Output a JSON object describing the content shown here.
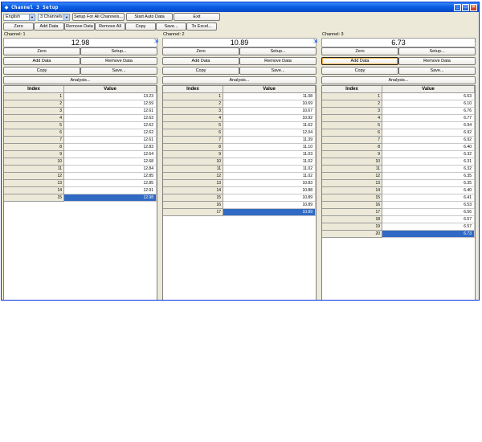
{
  "window": {
    "title": "Channel 3 Setup"
  },
  "toolbar1": {
    "language": "English",
    "channels": "3 Channels",
    "setup_all": "Setup For All Channels...",
    "start_auto": "Start Auto Data",
    "exit": "Exit"
  },
  "toolbar2": {
    "zero": "Zero",
    "add": "Add Data",
    "remove": "Remove Data",
    "remove_all": "Remove All",
    "copy": "Copy",
    "save": "Save...",
    "excel": "To Excel..."
  },
  "panel_buttons": {
    "zero": "Zero",
    "setup": "Setup...",
    "add": "Add Data",
    "remove": "Remove Data",
    "copy": "Copy",
    "save": "Save...",
    "analysis": "Analysis...",
    "index_header": "Index",
    "value_header": "Value"
  },
  "channels": [
    {
      "label": "Channel: 1",
      "reading": "12.98",
      "rows": [
        [
          "1",
          "13.23"
        ],
        [
          "2",
          "12.59"
        ],
        [
          "3",
          "12.61"
        ],
        [
          "4",
          "12.63"
        ],
        [
          "5",
          "12.62"
        ],
        [
          "6",
          "12.62"
        ],
        [
          "7",
          "12.61"
        ],
        [
          "8",
          "12.83"
        ],
        [
          "9",
          "12.64"
        ],
        [
          "10",
          "12.68"
        ],
        [
          "11",
          "12.84"
        ],
        [
          "12",
          "12.85"
        ],
        [
          "13",
          "12.85"
        ],
        [
          "14",
          "12.91"
        ],
        [
          "15",
          "12.98"
        ]
      ]
    },
    {
      "label": "Channel: 2",
      "reading": "10.89",
      "rows": [
        [
          "1",
          "11.08"
        ],
        [
          "2",
          "10.69"
        ],
        [
          "3",
          "10.67"
        ],
        [
          "4",
          "10.92"
        ],
        [
          "5",
          "11.62"
        ],
        [
          "6",
          "12.04"
        ],
        [
          "7",
          "11.39"
        ],
        [
          "8",
          "11.10"
        ],
        [
          "9",
          "11.03"
        ],
        [
          "10",
          "11.02"
        ],
        [
          "11",
          "11.02"
        ],
        [
          "12",
          "11.02"
        ],
        [
          "13",
          "10.83"
        ],
        [
          "14",
          "10.88"
        ],
        [
          "15",
          "10.89"
        ],
        [
          "16",
          "10.89"
        ],
        [
          "17",
          "10.89"
        ]
      ]
    },
    {
      "label": "Channel: 3",
      "reading": "6.73",
      "rows": [
        [
          "1",
          "6.53"
        ],
        [
          "2",
          "6.10"
        ],
        [
          "3",
          "6.76"
        ],
        [
          "4",
          "6.77"
        ],
        [
          "5",
          "6.94"
        ],
        [
          "6",
          "6.92"
        ],
        [
          "7",
          "6.92"
        ],
        [
          "8",
          "6.40"
        ],
        [
          "9",
          "6.32"
        ],
        [
          "10",
          "6.31"
        ],
        [
          "11",
          "6.32"
        ],
        [
          "12",
          "6.35"
        ],
        [
          "13",
          "6.35"
        ],
        [
          "14",
          "6.40"
        ],
        [
          "15",
          "6.41"
        ],
        [
          "16",
          "6.53"
        ],
        [
          "17",
          "6.56"
        ],
        [
          "18",
          "6.57"
        ],
        [
          "19",
          "6.57"
        ],
        [
          "20",
          "6.73"
        ]
      ]
    }
  ]
}
